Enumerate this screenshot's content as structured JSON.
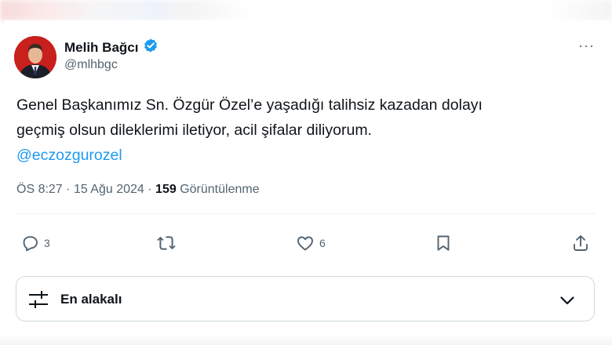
{
  "author": {
    "name": "Melih Bağcı",
    "handle": "@mlhbgc",
    "verified": true,
    "verified_color": "#1d9bf0"
  },
  "more_label": "···",
  "tweet": {
    "line1": "Genel Başkanımız Sn. Özgür Özel’e yaşadığı talihsiz kazadan dolayı",
    "line2": "geçmiş olsun dileklerimi iletiyor, acil şifalar diliyorum.",
    "mention": "@eczozgurozel"
  },
  "meta": {
    "time": "ÖS 8:27",
    "date": "15 Ağu 2024",
    "views": "159",
    "views_label": "Görüntülenme"
  },
  "actions": {
    "replies": "3",
    "retweets": "",
    "likes": "6"
  },
  "sort": {
    "label": "En alakalı"
  },
  "colors": {
    "text": "#0f1419",
    "muted": "#536471",
    "accent": "#1d9bf0",
    "border": "#cfd9de"
  }
}
